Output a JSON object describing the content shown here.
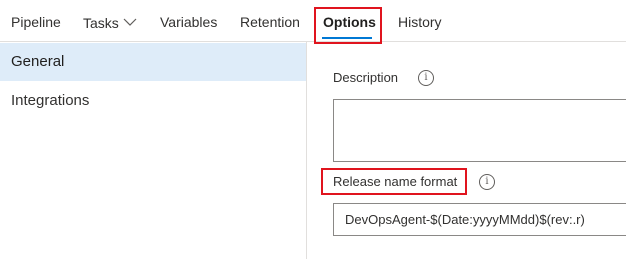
{
  "tabs": {
    "pipeline": "Pipeline",
    "tasks": "Tasks",
    "variables": "Variables",
    "retention": "Retention",
    "options": "Options",
    "history": "History"
  },
  "active_tab": "Options",
  "left_nav": {
    "general": "General",
    "integrations": "Integrations",
    "selected": "General"
  },
  "form": {
    "description_label": "Description",
    "description_value": "",
    "release_name_label": "Release name format",
    "release_name_value": "DevOpsAgent-$(Date:yyyyMMdd)$(rev:.r)"
  },
  "icons": {
    "tasks_dropdown": "chevron-down-icon",
    "description_info": "info-icon",
    "release_name_info": "info-icon"
  },
  "colors": {
    "accent": "#0078d4",
    "selected_nav_bg": "#deecf9",
    "highlight_box": "#e0141e"
  }
}
